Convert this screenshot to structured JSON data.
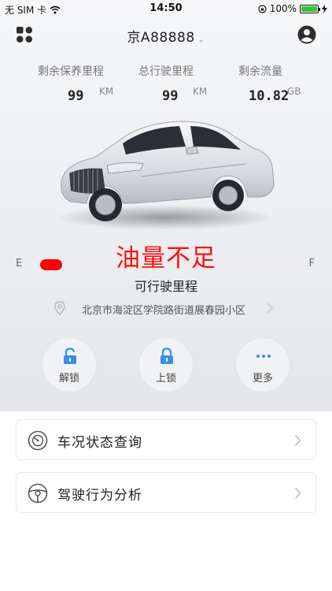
{
  "status_bar": {
    "carrier": "无 SIM 卡",
    "time": "14:50",
    "battery_percent": "100%",
    "icons": [
      "wifi-icon",
      "orientation-lock-icon",
      "battery-icon",
      "charging-icon"
    ]
  },
  "header": {
    "plate": "京A88888",
    "icons": [
      "apps-grid-icon",
      "chevron-down-icon",
      "user-avatar-icon"
    ]
  },
  "stats": [
    {
      "label": "剩余保养里程",
      "value": "99",
      "unit": "KM"
    },
    {
      "label": "总行驶里程",
      "value": "99",
      "unit": "KM"
    },
    {
      "label": "剩余流量",
      "value": "10.82",
      "unit": "GB"
    }
  ],
  "car_image": {
    "icon": "car-image"
  },
  "fuel": {
    "warning": "油量不足",
    "empty_label": "E",
    "full_label": "F",
    "level_fraction": 0.04,
    "bar_color": "#ff0000",
    "range_label": "可行驶里程"
  },
  "location": {
    "address": "北京市海淀区学院路街道展春园小区",
    "icons": [
      "location-pin-icon",
      "chevron-right-icon"
    ]
  },
  "actions": [
    {
      "label": "解锁",
      "icon": "unlock-icon"
    },
    {
      "label": "上锁",
      "icon": "lock-icon"
    },
    {
      "label": "更多",
      "icon": "more-dots-icon"
    }
  ],
  "menu": [
    {
      "label": "车况状态查询",
      "icon": "speedometer-icon"
    },
    {
      "label": "驾驶行为分析",
      "icon": "steering-wheel-icon"
    }
  ],
  "colors": {
    "accent": "#3a8ee6",
    "warning": "#ff1010",
    "battery": "#3cc13b"
  }
}
